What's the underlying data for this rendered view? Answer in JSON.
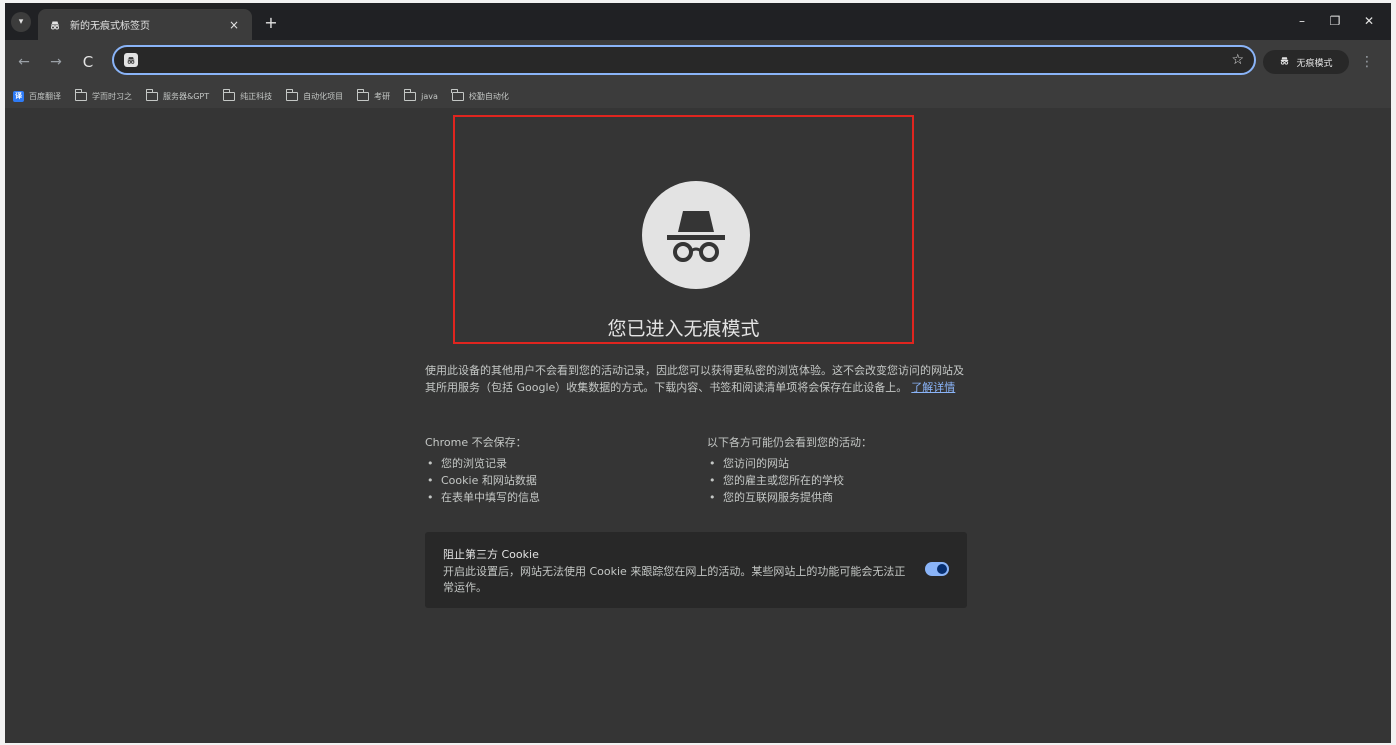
{
  "tab": {
    "title": "新的无痕式标签页",
    "close_glyph": "×",
    "new_tab_glyph": "+"
  },
  "window_controls": {
    "minimize": "–",
    "restore": "❐",
    "close": "✕"
  },
  "toolbar": {
    "back": "←",
    "forward": "→",
    "reload": "C",
    "omnibox_value": "",
    "star": "☆",
    "incognito_label": "无痕模式",
    "menu": "⋮"
  },
  "bookmarks": [
    {
      "label": "百度翻译",
      "type": "site"
    },
    {
      "label": "学而时习之",
      "type": "folder"
    },
    {
      "label": "服务器&GPT",
      "type": "folder"
    },
    {
      "label": "纯正科技",
      "type": "folder"
    },
    {
      "label": "自动化项目",
      "type": "folder"
    },
    {
      "label": "考研",
      "type": "folder"
    },
    {
      "label": "java",
      "type": "folder"
    },
    {
      "label": "校勤自动化",
      "type": "folder"
    }
  ],
  "main": {
    "headline": "您已进入无痕模式",
    "description": "使用此设备的其他用户不会看到您的活动记录，因此您可以获得更私密的浏览体验。这不会改变您访问的网站及其所用服务（包括 Google）收集数据的方式。下载内容、书签和阅读清单项将会保存在此设备上。",
    "learn_more": "了解详情",
    "not_saved_heading": "Chrome 不会保存：",
    "not_saved_items": [
      "您的浏览记录",
      "Cookie 和网站数据",
      "在表单中填写的信息"
    ],
    "visible_heading": "以下各方可能仍会看到您的活动：",
    "visible_items": [
      "您访问的网站",
      "您的雇主或您所在的学校",
      "您的互联网服务提供商"
    ],
    "cookie_title": "阻止第三方 Cookie",
    "cookie_text": "开启此设置后，网站无法使用 Cookie 来跟踪您在网上的活动。某些网站上的功能可能会无法正常运作。",
    "cookie_toggle_on": true
  },
  "colors": {
    "highlight_border": "#e0251f",
    "accent": "#8ab4f8",
    "background": "#353535"
  }
}
